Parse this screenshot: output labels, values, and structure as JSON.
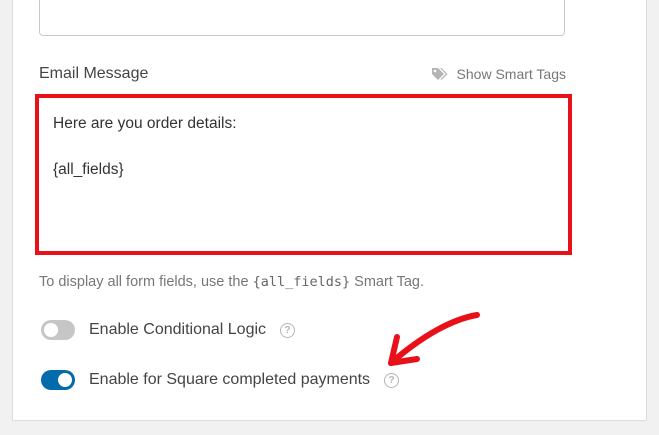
{
  "email_message": {
    "label": "Email Message",
    "smart_tags_link": "Show Smart Tags",
    "smart_tags_icon": "tags-icon",
    "editor_lines": [
      "Here are you order details:",
      "",
      "{all_fields}"
    ],
    "highlight_color": "#e8111a"
  },
  "help_text": {
    "prefix": "To display all form fields, use the ",
    "tag": "{all_fields}",
    "suffix": " Smart Tag."
  },
  "toggles": [
    {
      "label": "Enable Conditional Logic",
      "enabled": false,
      "help_icon": "question-circle-icon"
    },
    {
      "label": "Enable for Square completed payments",
      "enabled": true,
      "help_icon": "question-circle-icon"
    }
  ],
  "colors": {
    "toggle_on": "#036aab",
    "toggle_off": "#c6c6c6",
    "annotation_arrow": "#e8111a"
  }
}
